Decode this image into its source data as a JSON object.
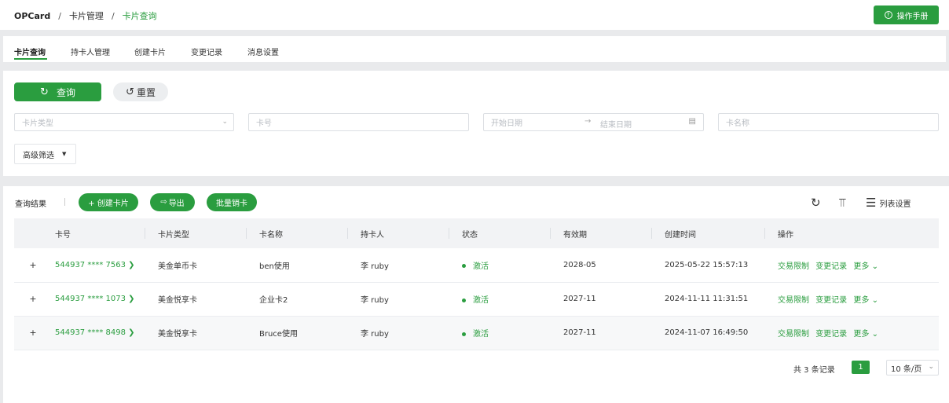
{
  "header": {
    "breadcrumb": {
      "home": "OPCard",
      "sep": "/",
      "mid": "卡片管理",
      "current": "卡片查询"
    },
    "manual_button": "操作手册",
    "manual_icon": "help-circle-icon"
  },
  "tabs": [
    {
      "label": "卡片查询",
      "active": true
    },
    {
      "label": "持卡人管理",
      "active": false
    },
    {
      "label": "创建卡片",
      "active": false
    },
    {
      "label": "变更记录",
      "active": false
    },
    {
      "label": "消息设置",
      "active": false
    }
  ],
  "filter": {
    "query_button": "查询",
    "reset_button": "重置",
    "card_type_placeholder": "卡片类型",
    "card_no_placeholder": "卡号",
    "start_date_placeholder": "开始日期",
    "end_date_placeholder": "结束日期",
    "card_name_placeholder": "卡名称",
    "advanced_filter": "高级筛选"
  },
  "results": {
    "label": "查询结果",
    "create_button": "+ 创建卡片",
    "export_button": "导出",
    "batch_cancel_button": "批量销卡",
    "list_settings": "列表设置",
    "columns": [
      "卡号",
      "卡片类型",
      "卡名称",
      "持卡人",
      "状态",
      "有效期",
      "创建时间",
      "操作"
    ],
    "rows": [
      {
        "card_no": "544937 **** 7563",
        "card_type": "美金单币卡",
        "card_name": "ben使用",
        "holder": "李 ruby",
        "status": "激活",
        "expiry": "2028-05",
        "created": "2025-05-22 15:57:13"
      },
      {
        "card_no": "544937 **** 1073",
        "card_type": "美金悦享卡",
        "card_name": "企业卡2",
        "holder": "李 ruby",
        "status": "激活",
        "expiry": "2027-11",
        "created": "2024-11-11 11:31:51"
      },
      {
        "card_no": "544937 **** 8498",
        "card_type": "美金悦享卡",
        "card_name": "Bruce使用",
        "holder": "李 ruby",
        "status": "激活",
        "expiry": "2027-11",
        "created": "2024-11-07 16:49:50"
      }
    ],
    "actions": {
      "limit": "交易限制",
      "history": "变更记录",
      "more": "更多"
    }
  },
  "pagination": {
    "total": "共 3 条记录",
    "current_page": "1",
    "page_size": "10 条/页"
  },
  "colors": {
    "accent": "#2a9d3f",
    "page_bg": "#e9eaec",
    "table_header": "#f2f3f5"
  }
}
